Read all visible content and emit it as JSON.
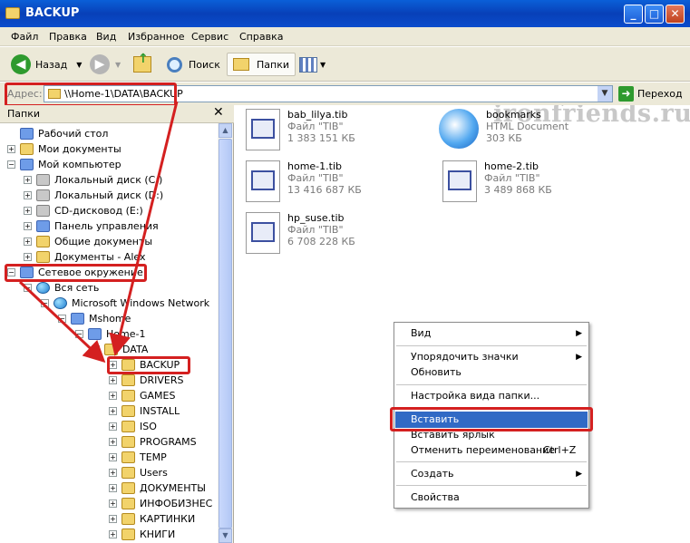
{
  "window": {
    "title": "BACKUP",
    "min": "_",
    "max": "□",
    "close": "✕"
  },
  "menu": [
    "Файл",
    "Правка",
    "Вид",
    "Избранное",
    "Сервис",
    "Справка"
  ],
  "toolbar": {
    "back": "Назад",
    "search": "Поиск",
    "folders": "Папки"
  },
  "watermark": "ironfriends.ru",
  "address": {
    "label": "Адрес:",
    "value": "\\\\Home-1\\DATA\\BACKUP",
    "go": "Переход"
  },
  "folders_pane": {
    "title": "Папки",
    "close": "✕"
  },
  "tree": [
    {
      "label": "Рабочий стол",
      "pm": "",
      "icon": "desktop-icon"
    },
    {
      "label": "Мои документы",
      "pm": "+",
      "icon": "folder-icon"
    },
    {
      "label": "Мой компьютер",
      "pm": "−",
      "icon": "computer-icon"
    },
    {
      "label": "Локальный диск (C:)",
      "pm": "+",
      "icon": "drive-icon"
    },
    {
      "label": "Локальный диск (D:)",
      "pm": "+",
      "icon": "drive-icon"
    },
    {
      "label": "CD-дисковод (E:)",
      "pm": "+",
      "icon": "cd-icon"
    },
    {
      "label": "Панель управления",
      "pm": "+",
      "icon": "control-panel-icon"
    },
    {
      "label": "Общие документы",
      "pm": "+",
      "icon": "folder-icon"
    },
    {
      "label": "Документы - Alex",
      "pm": "+",
      "icon": "folder-icon"
    },
    {
      "label": "Сетевое окружение",
      "pm": "−",
      "icon": "network-icon"
    },
    {
      "label": "Вся сеть",
      "pm": "−",
      "icon": "globe-icon"
    },
    {
      "label": "Microsoft Windows Network",
      "pm": "−",
      "icon": "globe-icon"
    },
    {
      "label": "Mshome",
      "pm": "−",
      "icon": "network-icon"
    },
    {
      "label": "Home-1",
      "pm": "−",
      "icon": "computer-icon"
    },
    {
      "label": "DATA",
      "pm": "−",
      "icon": "folder-icon"
    },
    {
      "label": "BACKUP",
      "pm": "+",
      "icon": "folder-icon"
    },
    {
      "label": "DRIVERS",
      "pm": "+",
      "icon": "folder-icon"
    },
    {
      "label": "GAMES",
      "pm": "+",
      "icon": "folder-icon"
    },
    {
      "label": "INSTALL",
      "pm": "+",
      "icon": "folder-icon"
    },
    {
      "label": "ISO",
      "pm": "+",
      "icon": "folder-icon"
    },
    {
      "label": "PROGRAMS",
      "pm": "+",
      "icon": "folder-icon"
    },
    {
      "label": "TEMP",
      "pm": "+",
      "icon": "folder-icon"
    },
    {
      "label": "Users",
      "pm": "+",
      "icon": "folder-icon"
    },
    {
      "label": "ДОКУМЕНТЫ",
      "pm": "+",
      "icon": "folder-icon"
    },
    {
      "label": "ИНФОБИЗНЕС",
      "pm": "+",
      "icon": "folder-icon"
    },
    {
      "label": "КАРТИНКИ",
      "pm": "+",
      "icon": "folder-icon"
    },
    {
      "label": "КНИГИ",
      "pm": "+",
      "icon": "folder-icon"
    }
  ],
  "files": [
    {
      "name": "bab_lilya.tib",
      "type": "Файл \"TIB\"",
      "size": "1 383 151 КБ"
    },
    {
      "name": "bookmarks",
      "type": "HTML Document",
      "size": "303 КБ"
    },
    {
      "name": "home-1.tib",
      "type": "Файл \"TIB\"",
      "size": "13 416 687 КБ"
    },
    {
      "name": "home-2.tib",
      "type": "Файл \"TIB\"",
      "size": "3 489 868 КБ"
    },
    {
      "name": "hp_suse.tib",
      "type": "Файл \"TIB\"",
      "size": "6 708 228 КБ"
    }
  ],
  "context_menu": {
    "view": "Вид",
    "arrange": "Упорядочить значки",
    "refresh": "Обновить",
    "customize": "Настройка вида папки...",
    "paste": "Вставить",
    "paste_shortcut": "Вставить ярлык",
    "undo_rename": "Отменить переименование",
    "undo_shortcut": "Ctrl+Z",
    "new": "Создать",
    "properties": "Свойства",
    "submenu_arrow": "▶"
  },
  "colors": {
    "highlight": "#316ac5",
    "annotation": "#d42020",
    "titlebar": "#0a4ccc"
  }
}
